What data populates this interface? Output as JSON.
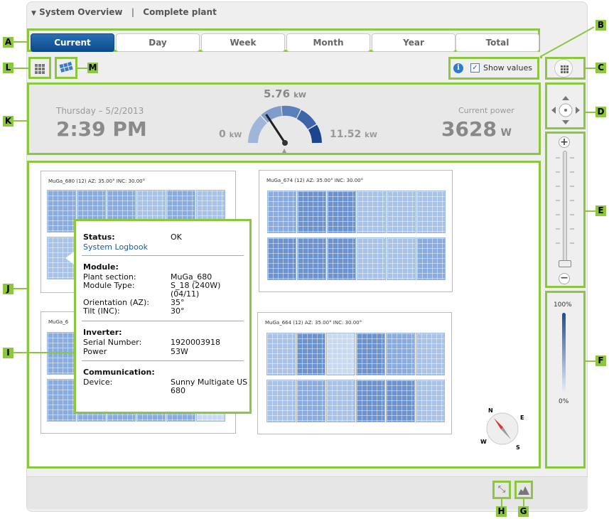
{
  "title": {
    "system": "System Overview",
    "plant": "Complete plant"
  },
  "tabs": [
    {
      "label": "Current",
      "active": true
    },
    {
      "label": "Day",
      "active": false
    },
    {
      "label": "Week",
      "active": false
    },
    {
      "label": "Month",
      "active": false
    },
    {
      "label": "Year",
      "active": false
    },
    {
      "label": "Total",
      "active": false
    }
  ],
  "toolbar": {
    "show_values_label": "Show values",
    "show_values_checked": true
  },
  "summary": {
    "date": "Thursday – 5/2/2013",
    "time": "2:39 PM",
    "gauge_peak": "5.76",
    "gauge_peak_unit": "kW",
    "gauge_min": "0",
    "gauge_min_unit": "kW",
    "gauge_max": "11.52",
    "gauge_max_unit": "kW",
    "current_power_label": "Current power",
    "current_power_value": "3628",
    "current_power_unit": "W",
    "gauge_level": 0.315
  },
  "modules": [
    {
      "caption": "MuGa_680 (12) AZ: 35.00° INC: 30.00°"
    },
    {
      "caption": "MuGa_674 (12) AZ: 35.00° INC: 30.00°"
    },
    {
      "caption": "MuGa_6"
    },
    {
      "caption": "MuGa_664 (12) AZ: 35.00° INC: 30.00°"
    }
  ],
  "popup": {
    "status_label": "Status:",
    "status_value": "OK",
    "logbook_link": "System Logbook",
    "module_heading": "Module:",
    "plant_section_label": "Plant section:",
    "plant_section_value": "MuGa_680",
    "module_type_label": "Module Type:",
    "module_type_value_1": "S_18 (240W)",
    "module_type_value_2": "(04/11)",
    "orientation_label": "Orientation (AZ):",
    "orientation_value": "35°",
    "tilt_label": "Tilt (INC):",
    "tilt_value": "30°",
    "inverter_heading": "Inverter:",
    "serial_label": "Serial Number:",
    "serial_value": "1920003918",
    "power_label": "Power",
    "power_value": "53W",
    "comm_heading": "Communication:",
    "device_label": "Device:",
    "device_value_1": "Sunny Multigate US",
    "device_value_2": "680"
  },
  "compass": {
    "n": "N",
    "e": "E",
    "s": "S",
    "w": "W"
  },
  "scale": {
    "top": "100%",
    "bottom": "0%"
  },
  "callouts": {
    "a": "A",
    "b": "B",
    "c": "C",
    "d": "D",
    "e": "E",
    "f": "F",
    "g": "G",
    "h": "H",
    "i": "I",
    "j": "J",
    "k": "K",
    "l": "L",
    "m": "M"
  },
  "colors": {
    "accent": "#8dc63f",
    "active_tab": "#0c4a8c",
    "module_blue": "#6d93cf"
  }
}
